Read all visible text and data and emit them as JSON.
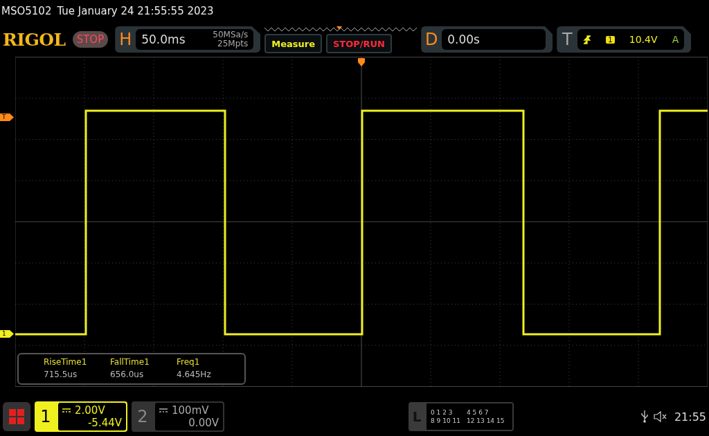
{
  "header": {
    "model": "MSO5102",
    "datetime": "Tue January 24 21:55:55 2023"
  },
  "toolbar": {
    "logo": "RIGOL",
    "run_state": "STOP",
    "horizontal": {
      "label": "H",
      "timebase": "50.0ms",
      "sample_rate": "50MSa/s",
      "memory_depth": "25Mpts"
    },
    "measure_button": "Measure",
    "stop_run_button": "STOP/RUN",
    "delay": {
      "label": "D",
      "value": "0.00s"
    },
    "trigger": {
      "label": "T",
      "source": "1",
      "level": "10.4V",
      "mode": "A"
    }
  },
  "markers": {
    "trigger_level": "T",
    "channel": "1"
  },
  "measurements": [
    {
      "name": "RiseTime1",
      "value": "715.5us"
    },
    {
      "name": "FallTime1",
      "value": "656.0us"
    },
    {
      "name": "Freq1",
      "value": "4.645Hz"
    }
  ],
  "channels": [
    {
      "number": "1",
      "scale": "2.00V",
      "offset": "-5.44V",
      "active": true
    },
    {
      "number": "2",
      "scale": "100mV",
      "offset": "0.00V",
      "active": false
    }
  ],
  "logic": {
    "label": "L",
    "rows": [
      [
        "0 1 2 3",
        "4 5 6 7"
      ],
      [
        "8 9 10 11",
        "12 13 14 15"
      ]
    ]
  },
  "status": {
    "time": "21:55"
  }
}
